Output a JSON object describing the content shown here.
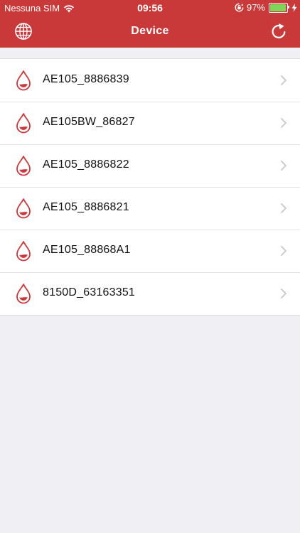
{
  "status_bar": {
    "carrier": "Nessuna SIM",
    "time": "09:56",
    "battery_percent": "97%",
    "battery_level": 0.97,
    "icons": [
      "wifi-icon",
      "orientation-lock-icon",
      "battery-icon",
      "charging-bolt-icon"
    ]
  },
  "header": {
    "title": "Device",
    "left_icon": "globe-icon",
    "right_icon": "refresh-icon",
    "background_color": "#c9393a"
  },
  "devices": [
    {
      "name": "AE105_8886839",
      "icon": "blood-drop-icon"
    },
    {
      "name": "AE105BW_86827",
      "icon": "blood-drop-icon"
    },
    {
      "name": "AE105_8886822",
      "icon": "blood-drop-icon"
    },
    {
      "name": "AE105_8886821",
      "icon": "blood-drop-icon"
    },
    {
      "name": "AE105_88868A1",
      "icon": "blood-drop-icon"
    },
    {
      "name": "8150D_63163351",
      "icon": "blood-drop-icon"
    }
  ],
  "colors": {
    "accent": "#c9393a",
    "background": "#efeff4",
    "chevron": "#c7c7cc"
  }
}
